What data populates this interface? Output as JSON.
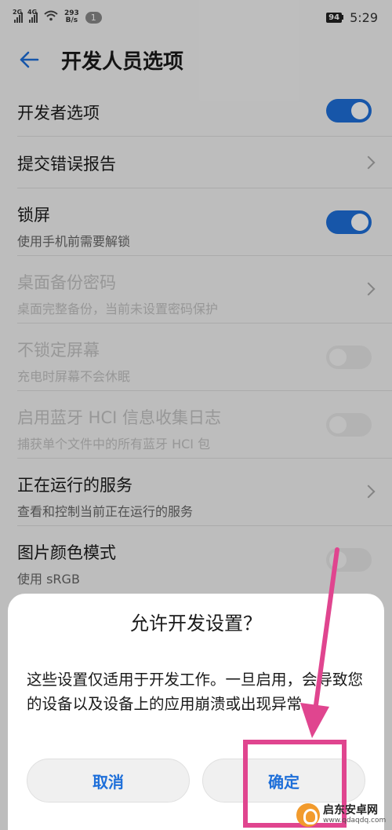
{
  "status": {
    "net1": "2G",
    "net2": "4G",
    "speed_value": "293",
    "speed_unit": "B/s",
    "notif_count": "1",
    "battery": "94",
    "time": "5:29"
  },
  "header": {
    "title": "开发人员选项"
  },
  "settings": [
    {
      "title": "开发者选项",
      "subtitle": "",
      "control": "toggle-on"
    },
    {
      "title": "提交错误报告",
      "subtitle": "",
      "control": "chevron"
    },
    {
      "title": "锁屏",
      "subtitle": "使用手机前需要解锁",
      "control": "toggle-on"
    },
    {
      "title": "桌面备份密码",
      "subtitle": "桌面完整备份，当前未设置密码保护",
      "control": "chevron",
      "disabled": true
    },
    {
      "title": "不锁定屏幕",
      "subtitle": "充电时屏幕不会休眠",
      "control": "toggle-off",
      "disabled": true
    },
    {
      "title": "启用蓝牙 HCI 信息收集日志",
      "subtitle": "捕获单个文件中的所有蓝牙 HCI 包",
      "control": "toggle-off",
      "disabled": true
    },
    {
      "title": "正在运行的服务",
      "subtitle": "查看和控制当前正在运行的服务",
      "control": "chevron"
    },
    {
      "title": "图片颜色模式",
      "subtitle": "使用 sRGB",
      "control": "toggle-off"
    }
  ],
  "dialog": {
    "title": "允许开发设置？",
    "body": "这些设置仅适用于开发工作。一旦启用，会导致您的设备以及设备上的应用崩溃或出现异常。",
    "cancel_label": "取消",
    "ok_label": "确定"
  },
  "watermark": {
    "name": "启东安卓网",
    "url": "www.qdaqdq.com"
  },
  "colors": {
    "accent": "#1e6fd9",
    "highlight": "#e0458f"
  }
}
